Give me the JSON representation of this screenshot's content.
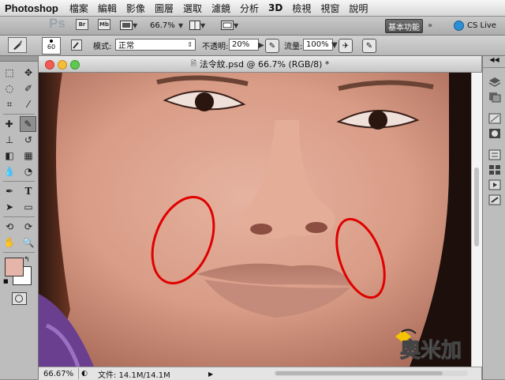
{
  "menubar": {
    "app_name": "Photoshop",
    "items": [
      "檔案",
      "編輯",
      "影像",
      "圖層",
      "選取",
      "濾鏡",
      "分析",
      "3D",
      "檢視",
      "視窗",
      "說明"
    ]
  },
  "appbar": {
    "logo": "Ps",
    "bridge": "Br",
    "minibridge": "Mb",
    "zoom": "66.7%",
    "workspace": "基本功能",
    "cs_live": "CS Live"
  },
  "options": {
    "brush_size": "60",
    "mode_label": "模式:",
    "mode_value": "正常",
    "opacity_label": "不透明:",
    "opacity_value": "20%",
    "flow_label": "流量:",
    "flow_value": "100%"
  },
  "document": {
    "title": "法令紋.psd @ 66.7% (RGB/8) *",
    "status_zoom": "66.67%",
    "status_info": "文件: 14.1M/14.1M",
    "watermark": "奧米加"
  },
  "colors": {
    "foreground": "#e6b5aa",
    "background": "#ffffff",
    "annotation": "#e00000"
  }
}
